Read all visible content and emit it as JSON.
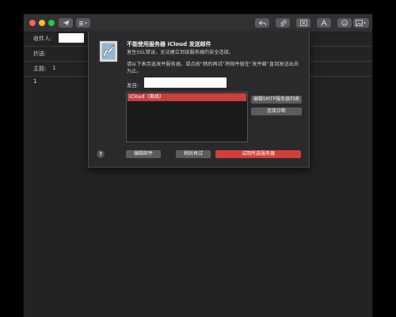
{
  "fields": {
    "to_label": "收件人:",
    "cc_label": "抄送:",
    "subject_label": "主题:",
    "subject_value": "1"
  },
  "body": {
    "text": "1"
  },
  "dialog": {
    "title": "不能使用服务器 iCloud 发送邮件",
    "subtitle": "发生SSL错误，无法建立到该服务器的安全连接。",
    "info": "请从下表另选发件服务器，或点按“稍后再试”将邮件留在“发件箱”直到发送出去为止。",
    "sender_label": "发自:",
    "servers": [
      {
        "label": "iCloud（离线）",
        "selected": true
      }
    ],
    "edit_smtp_list_button": "编辑SMTP服务器列表",
    "connection_doctor_button": "连接诊断",
    "help_button": "?",
    "edit_message_button": "编辑邮件",
    "try_later_button": "稍后再试",
    "try_selected_button": "试用所选服务器"
  },
  "colors": {
    "accent_red": "#d23f3b",
    "window_bg": "#232324"
  }
}
